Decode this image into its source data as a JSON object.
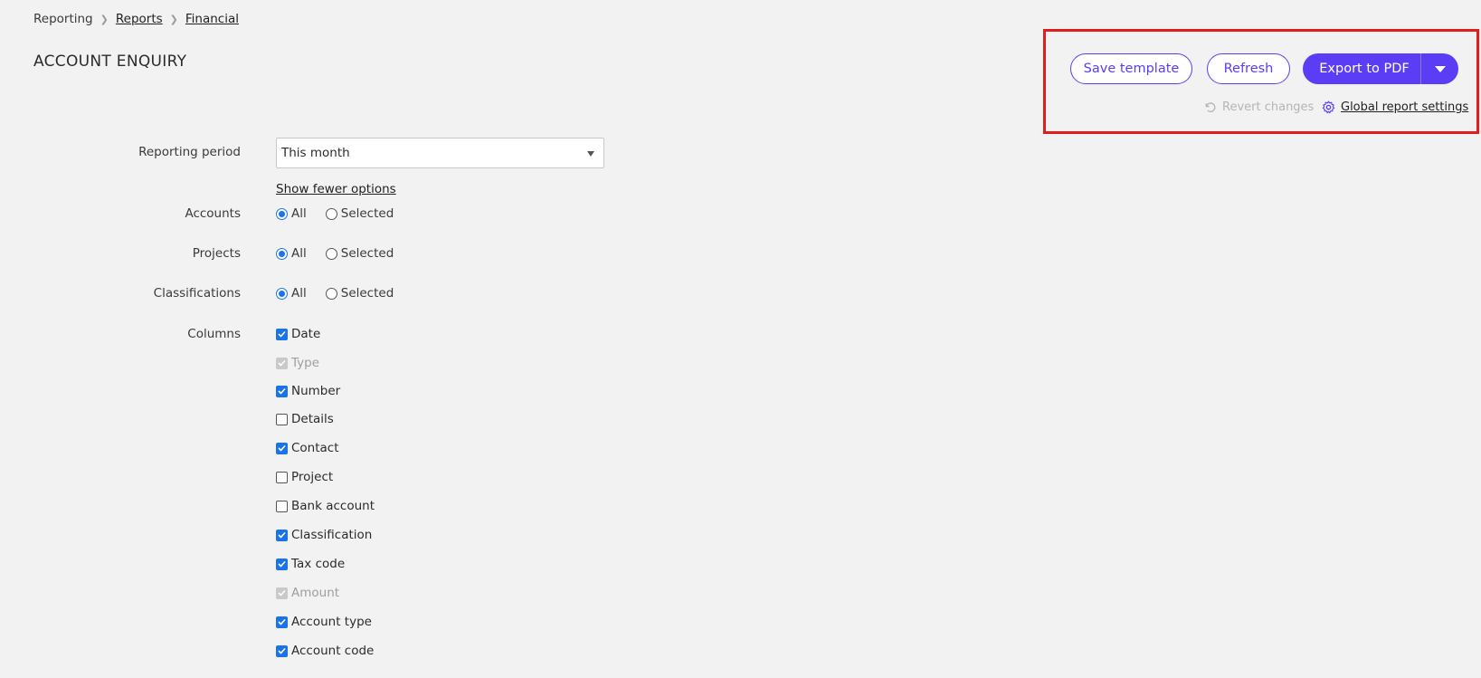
{
  "breadcrumb": {
    "root": "Reporting",
    "level1": "Reports",
    "level2": "Financial"
  },
  "page": {
    "title": "ACCOUNT ENQUIRY"
  },
  "actions": {
    "save_template": "Save template",
    "refresh": "Refresh",
    "export_pdf": "Export to PDF",
    "revert_changes": "Revert changes",
    "global_settings": "Global report settings"
  },
  "form": {
    "reporting_period": {
      "label": "Reporting period",
      "value": "This month"
    },
    "show_fewer": "Show fewer options",
    "accounts": {
      "label": "Accounts",
      "opt_all": "All",
      "opt_selected": "Selected",
      "selected": "All"
    },
    "projects": {
      "label": "Projects",
      "opt_all": "All",
      "opt_selected": "Selected",
      "selected": "All"
    },
    "classifications": {
      "label": "Classifications",
      "opt_all": "All",
      "opt_selected": "Selected",
      "selected": "All"
    },
    "columns_label": "Columns",
    "columns": [
      {
        "label": "Date",
        "checked": true,
        "disabled": false
      },
      {
        "label": "Type",
        "checked": true,
        "disabled": true
      },
      {
        "label": "Number",
        "checked": true,
        "disabled": false
      },
      {
        "label": "Details",
        "checked": false,
        "disabled": false
      },
      {
        "label": "Contact",
        "checked": true,
        "disabled": false
      },
      {
        "label": "Project",
        "checked": false,
        "disabled": false
      },
      {
        "label": "Bank account",
        "checked": false,
        "disabled": false
      },
      {
        "label": "Classification",
        "checked": true,
        "disabled": false
      },
      {
        "label": "Tax code",
        "checked": true,
        "disabled": false
      },
      {
        "label": "Amount",
        "checked": true,
        "disabled": true
      },
      {
        "label": "Account type",
        "checked": true,
        "disabled": false
      },
      {
        "label": "Account code",
        "checked": true,
        "disabled": false
      }
    ]
  },
  "colors": {
    "accent": "#5b3df5",
    "checkbox": "#1a73e8",
    "highlight_border": "#e01e1e",
    "background": "#f2f2f2"
  }
}
